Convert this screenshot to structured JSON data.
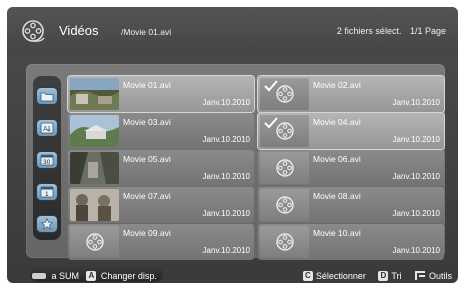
{
  "header": {
    "title": "Vidéos",
    "path": "/Movie 01.avi",
    "selection_status": "2 fichiers sélect.",
    "page": "1/1 Page",
    "icon": "film-reel-icon"
  },
  "sidebar": {
    "items": [
      {
        "icon": "folder-icon"
      },
      {
        "icon": "sort-alpha-icon"
      },
      {
        "icon": "calendar-icon",
        "label": "30"
      },
      {
        "icon": "calendar-icon-2",
        "label": "1"
      },
      {
        "icon": "star-icon"
      }
    ]
  },
  "items": [
    {
      "name": "Movie 01.avi",
      "date": "Janv.10.2010"
    },
    {
      "name": "Movie 02.avi",
      "date": "Janv.10.2010"
    },
    {
      "name": "Movie 03.avi",
      "date": "Janv.10.2010"
    },
    {
      "name": "Movie 04.avi",
      "date": "Janv.10.2010"
    },
    {
      "name": "Movie 05.avi",
      "date": "Janv.10.2010"
    },
    {
      "name": "Movie 06.avi",
      "date": "Janv.10.2010"
    },
    {
      "name": "Movie 07.avi",
      "date": "Janv.10.2010"
    },
    {
      "name": "Movie 08.avi",
      "date": "Janv.10.2010"
    },
    {
      "name": "Movie 09.avi",
      "date": "Janv.10.2010"
    },
    {
      "name": "Movie 10.avi",
      "date": "Janv.10.2010"
    }
  ],
  "footer": {
    "sum_label": "a SUM",
    "key_a": "A",
    "change_label": "Changer disp.",
    "key_c": "C",
    "select_label": "Sélectionner",
    "key_d": "D",
    "sort_label": "Tri",
    "tools_label": "Outils",
    "tools_icon": "tools-icon"
  },
  "colors": {
    "background": "#3a3a3a",
    "panel": "#6e6e6e",
    "sidebar_button": "#8fb3cf"
  }
}
